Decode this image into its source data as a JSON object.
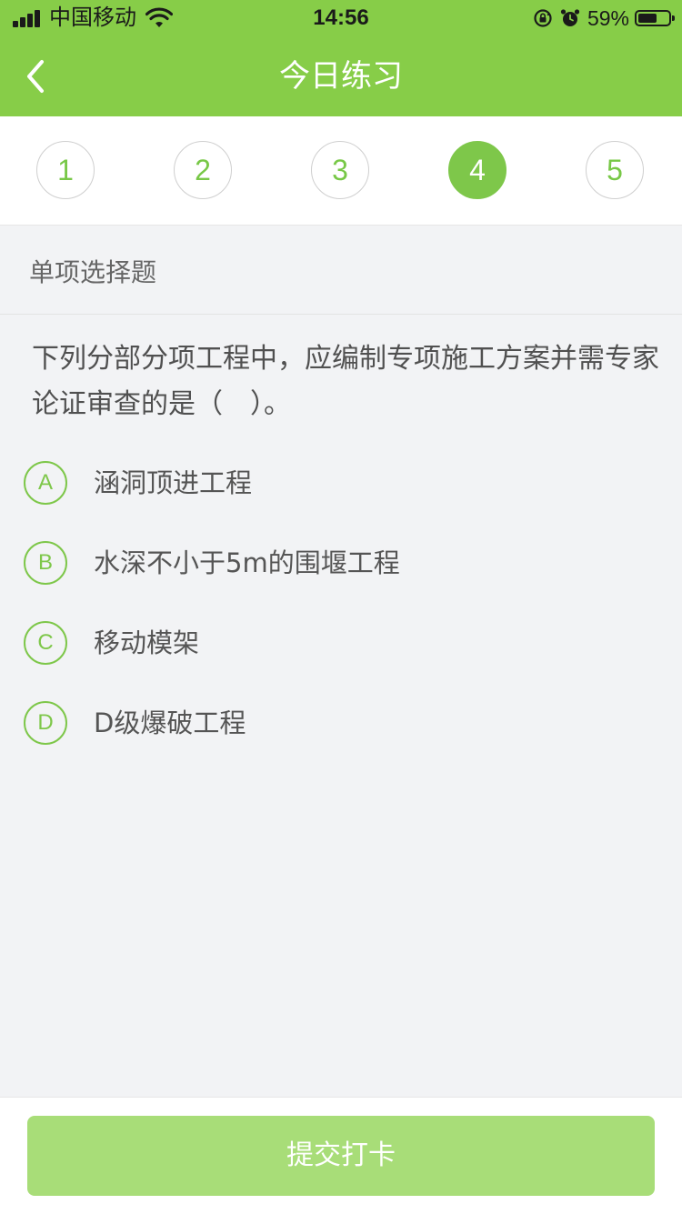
{
  "status_bar": {
    "carrier": "中国移动",
    "time": "14:56",
    "battery_percent": "59%",
    "icons": [
      "signal-icon",
      "wifi-icon",
      "rotation-lock-icon",
      "alarm-icon",
      "battery-icon"
    ]
  },
  "nav": {
    "title": "今日练习",
    "back_icon": "chevron-left-icon"
  },
  "question_numbers": [
    {
      "label": "1",
      "active": false
    },
    {
      "label": "2",
      "active": false
    },
    {
      "label": "3",
      "active": false
    },
    {
      "label": "4",
      "active": true
    },
    {
      "label": "5",
      "active": false
    }
  ],
  "question": {
    "type": "单项选择题",
    "stem": "下列分部分项工程中，应编制专项施工方案并需专家论证审查的是（　）。",
    "options": [
      {
        "letter": "A",
        "text": "涵洞顶进工程"
      },
      {
        "letter": "B",
        "text": "水深不小于5m的围堰工程"
      },
      {
        "letter": "C",
        "text": "移动模架"
      },
      {
        "letter": "D",
        "text": "D级爆破工程"
      }
    ]
  },
  "footer": {
    "submit_label": "提交打卡"
  },
  "colors": {
    "brand_green": "#87cd48",
    "active_green": "#7ec74a",
    "submit_disabled": "#a8dd78",
    "background": "#f2f3f5"
  }
}
